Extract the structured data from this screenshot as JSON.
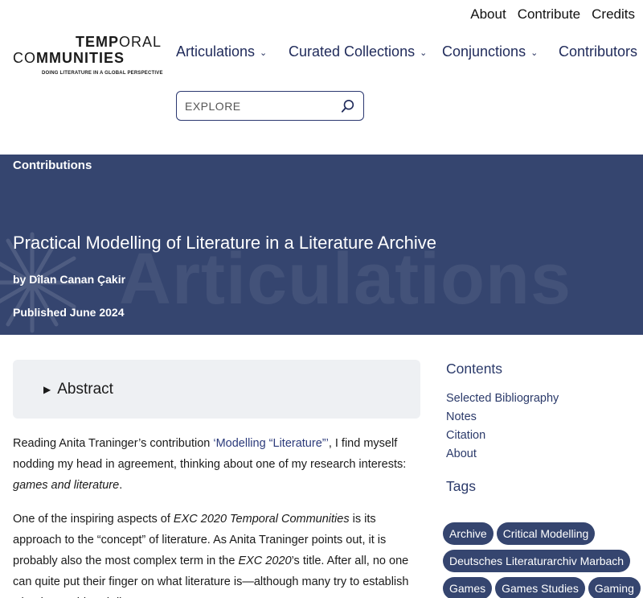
{
  "top_nav": [
    "About",
    "Contribute",
    "Credits"
  ],
  "logo": {
    "line1_a": "TEMP",
    "line1_b": "ORAL",
    "line2_a": "C",
    "line2_b": "O",
    "line2_c": "MMUNITIES",
    "tagline": "DOING LITERATURE IN A GLOBAL PERSPECTIVE"
  },
  "main_nav": [
    {
      "label": "Articulations",
      "dropdown": true
    },
    {
      "label": "Curated Collections",
      "dropdown": true
    },
    {
      "label": "Conjunctions",
      "dropdown": true
    },
    {
      "label": "Contributors",
      "dropdown": false
    }
  ],
  "search": {
    "placeholder": "EXPLORE",
    "value": ""
  },
  "hero": {
    "breadcrumb": "Contributions",
    "watermark": "Articulations",
    "title": "Practical Modelling of Literature in a Literature Archive",
    "byline": "by Dîlan Canan Çakir",
    "published": "Published June 2024"
  },
  "abstract": {
    "label": "Abstract"
  },
  "article": {
    "p1_a": "Reading Anita Traninger’s contribution ",
    "p1_link": "‘Modelling “Literature”’",
    "p1_b": ", I find myself nodding my head in agreement, thinking about one of my research interests: ",
    "p1_em": "games and literature",
    "p1_c": ".",
    "p2_a": "One of the inspiring aspects of ",
    "p2_em1": "EXC 2020 Temporal Communities",
    "p2_b": " is its approach to the “concept” of literature. As Anita Traninger points out, it is probably also the most complex term in the ",
    "p2_em2": "EXC 2020",
    "p2_c": "’s title. After all, no one can quite put their finger on what literature is—although many try to establish what is considered “literature”."
  },
  "sidebar": {
    "contents_heading": "Contents",
    "contents": [
      "Selected Bibliography",
      "Notes",
      "Citation",
      "About"
    ],
    "tags_heading": "Tags",
    "tags": [
      "Archive",
      "Critical Modelling",
      "Deutsches Literaturarchiv Marbach",
      "Games",
      "Games Studies",
      "Gaming"
    ]
  },
  "colors": {
    "hero_bg": "#35456f",
    "accent": "#2b3a6a",
    "tag_bg": "#35456f",
    "abstract_bg": "#eef0f3"
  }
}
